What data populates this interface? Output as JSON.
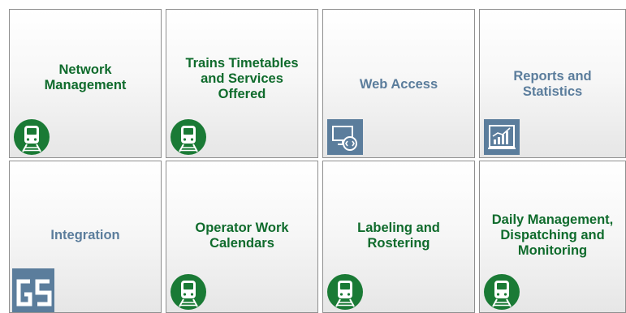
{
  "tiles": [
    {
      "label": "Network Management",
      "icon": "train-icon"
    },
    {
      "label": "Trains Timetables and Services Offered",
      "icon": "train-icon"
    },
    {
      "label": "Web Access",
      "icon": "remote-desktop-icon"
    },
    {
      "label": "Reports and Statistics",
      "icon": "chart-report-icon"
    },
    {
      "label": "Integration",
      "icon": "gs-logo-icon"
    },
    {
      "label": "Operator Work Calendars",
      "icon": "train-icon"
    },
    {
      "label": "Labeling and Rostering",
      "icon": "train-icon"
    },
    {
      "label": "Daily Management, Dispatching and Monitoring",
      "icon": "train-icon"
    }
  ],
  "colors": {
    "green_text": "#0f6b2c",
    "blue_text": "#5b7d9c",
    "green_icon": "#1a7a35",
    "blue_icon": "#5b7d9c"
  }
}
